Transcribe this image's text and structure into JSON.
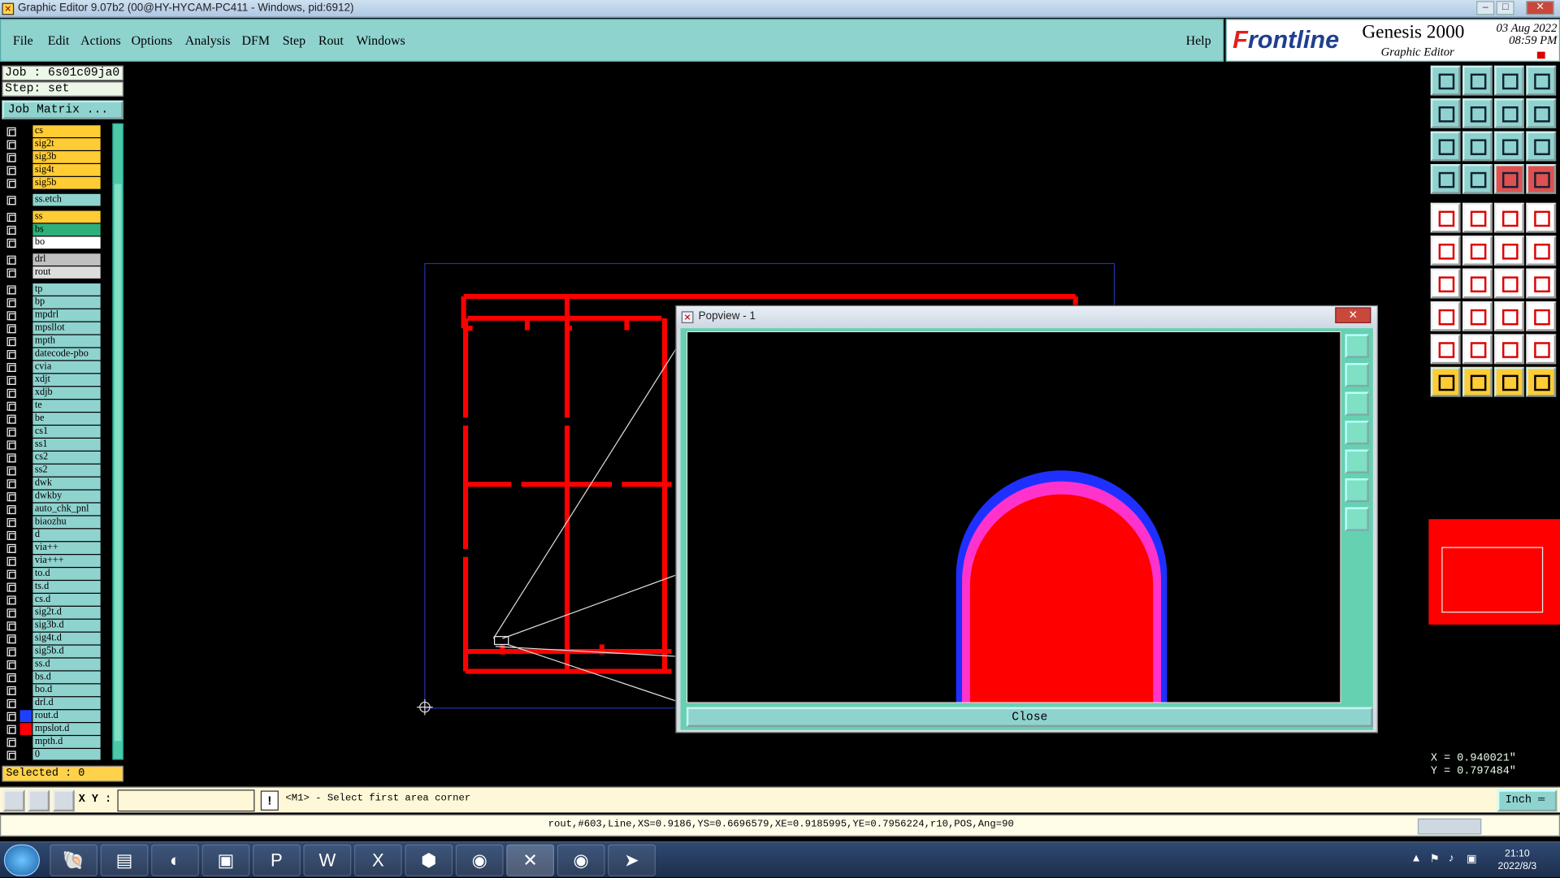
{
  "window": {
    "title": "Graphic Editor 9.07b2 (00@HY-HYCAM-PC411 - Windows, pid:6912)",
    "controls": [
      "–",
      "□",
      "✕"
    ]
  },
  "menu": {
    "items": [
      "File",
      "Edit",
      "Actions",
      "Options",
      "Analysis",
      "DFM",
      "Step",
      "Rout",
      "Windows"
    ],
    "help": "Help"
  },
  "brand": {
    "logo_f": "F",
    "logo_rest": "rontline",
    "product": "Genesis 2000",
    "subtitle": "Graphic Editor",
    "date_line1": "03  Aug  2022",
    "date_line2": "08:59  PM"
  },
  "job": {
    "job_line": "Job : 6s01c09ja0",
    "step_line": "Step: set",
    "job_matrix_button": "Job Matrix ..."
  },
  "layers": [
    {
      "name": "cs",
      "color": "#ffcc33",
      "swatch": "#000000"
    },
    {
      "name": "sig2t",
      "color": "#ffcc33",
      "swatch": "#000000"
    },
    {
      "name": "sig3b",
      "color": "#ffcc33",
      "swatch": "#000000"
    },
    {
      "name": "sig4t",
      "color": "#ffcc33",
      "swatch": "#000000"
    },
    {
      "name": "sig5b",
      "color": "#ffcc33",
      "swatch": "#000000"
    },
    {
      "name": "ss.etch",
      "color": "#8fd3cf",
      "swatch": "#000000",
      "gap": true
    },
    {
      "name": "ss",
      "color": "#ffcc33",
      "swatch": "#000000",
      "gap": true
    },
    {
      "name": "bs",
      "color": "#2fb07a",
      "swatch": "#000000"
    },
    {
      "name": "bo",
      "color": "#ffffff",
      "swatch": "#000000"
    },
    {
      "name": "drl",
      "color": "#c0c0c0",
      "swatch": "#000000",
      "gap": true
    },
    {
      "name": "rout",
      "color": "#dddddd",
      "swatch": "#000000"
    },
    {
      "name": "tp",
      "color": "#8fd3cf",
      "swatch": "#000000",
      "gap": true
    },
    {
      "name": "bp",
      "color": "#8fd3cf",
      "swatch": "#000000"
    },
    {
      "name": "mpdrl",
      "color": "#8fd3cf",
      "swatch": "#000000"
    },
    {
      "name": "mpsllot",
      "color": "#8fd3cf",
      "swatch": "#000000"
    },
    {
      "name": "mpth",
      "color": "#8fd3cf",
      "swatch": "#000000"
    },
    {
      "name": "datecode-pbo",
      "color": "#8fd3cf",
      "swatch": "#000000"
    },
    {
      "name": "cvia",
      "color": "#8fd3cf",
      "swatch": "#000000"
    },
    {
      "name": "xdjt",
      "color": "#8fd3cf",
      "swatch": "#000000"
    },
    {
      "name": "xdjb",
      "color": "#8fd3cf",
      "swatch": "#000000"
    },
    {
      "name": "te",
      "color": "#8fd3cf",
      "swatch": "#000000"
    },
    {
      "name": "be",
      "color": "#8fd3cf",
      "swatch": "#000000"
    },
    {
      "name": "cs1",
      "color": "#8fd3cf",
      "swatch": "#000000"
    },
    {
      "name": "ss1",
      "color": "#8fd3cf",
      "swatch": "#000000"
    },
    {
      "name": "cs2",
      "color": "#8fd3cf",
      "swatch": "#000000"
    },
    {
      "name": "ss2",
      "color": "#8fd3cf",
      "swatch": "#000000"
    },
    {
      "name": "dwk",
      "color": "#8fd3cf",
      "swatch": "#000000"
    },
    {
      "name": "dwkby",
      "color": "#8fd3cf",
      "swatch": "#000000"
    },
    {
      "name": "auto_chk_pnl",
      "color": "#8fd3cf",
      "swatch": "#000000"
    },
    {
      "name": "biaozhu",
      "color": "#8fd3cf",
      "swatch": "#000000"
    },
    {
      "name": "d",
      "color": "#8fd3cf",
      "swatch": "#000000"
    },
    {
      "name": "via++",
      "color": "#8fd3cf",
      "swatch": "#000000"
    },
    {
      "name": "via+++",
      "color": "#8fd3cf",
      "swatch": "#000000"
    },
    {
      "name": "to.d",
      "color": "#8fd3cf",
      "swatch": "#000000"
    },
    {
      "name": "ts.d",
      "color": "#8fd3cf",
      "swatch": "#000000"
    },
    {
      "name": "cs.d",
      "color": "#8fd3cf",
      "swatch": "#000000"
    },
    {
      "name": "sig2t.d",
      "color": "#8fd3cf",
      "swatch": "#000000"
    },
    {
      "name": "sig3b.d",
      "color": "#8fd3cf",
      "swatch": "#000000"
    },
    {
      "name": "sig4t.d",
      "color": "#8fd3cf",
      "swatch": "#000000"
    },
    {
      "name": "sig5b.d",
      "color": "#8fd3cf",
      "swatch": "#000000"
    },
    {
      "name": "ss.d",
      "color": "#8fd3cf",
      "swatch": "#000000"
    },
    {
      "name": "bs.d",
      "color": "#8fd3cf",
      "swatch": "#000000"
    },
    {
      "name": "bo.d",
      "color": "#8fd3cf",
      "swatch": "#000000"
    },
    {
      "name": "drl.d",
      "color": "#8fd3cf",
      "swatch": "#000000"
    },
    {
      "name": "rout.d",
      "color": "#8fd3cf",
      "swatch": "#1f3fff"
    },
    {
      "name": "mpslot.d",
      "color": "#8fd3cf",
      "swatch": "#ff0000"
    },
    {
      "name": "mpth.d",
      "color": "#8fd3cf",
      "swatch": "#000000"
    },
    {
      "name": "0",
      "color": "#8fd3cf",
      "swatch": "#000000"
    }
  ],
  "selected": "Selected : 0",
  "popview": {
    "title": "Popview - 1",
    "close_button": "Close"
  },
  "coords": {
    "x": "X = 0.940021\"",
    "y": "Y = 0.797484\""
  },
  "command": {
    "xy_label": "X Y :",
    "xy_value": "",
    "alert": "!",
    "prompt": "<M1> - Select first area corner",
    "unit": "Inch ═"
  },
  "status": {
    "text": "rout,#603,Line,XS=0.9186,YS=0.6696579,XE=0.9185995,YE=0.7956224,r10,POS,Ang=90"
  },
  "taskbar": {
    "time": "21:10",
    "date": "2022/8/3",
    "apps": [
      "shell",
      "notepad",
      "redfish",
      "save",
      "project",
      "word",
      "excel",
      "pdf",
      "eye",
      "genesis",
      "eye2",
      "arrow"
    ]
  }
}
